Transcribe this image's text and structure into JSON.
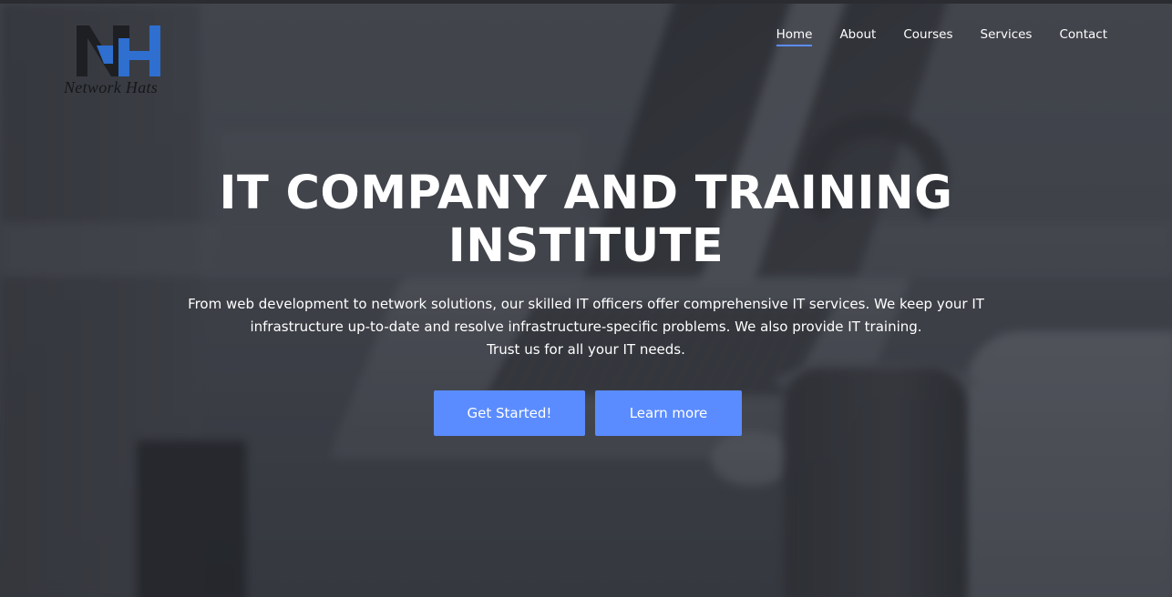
{
  "brand": {
    "logo_text": "Network Hats",
    "logo_icon": "nh-logo-icon",
    "logo_colors": {
      "dark": "#1e1f22",
      "blue": "#2e6fd0"
    }
  },
  "nav": {
    "items": [
      {
        "label": "Home",
        "active": true
      },
      {
        "label": "About",
        "active": false
      },
      {
        "label": "Courses",
        "active": false
      },
      {
        "label": "Services",
        "active": false
      },
      {
        "label": "Contact",
        "active": false
      }
    ],
    "active_color": "#5b8cff"
  },
  "hero": {
    "title_line1": "IT COMPANY AND TRAINING",
    "title_line2": "INSTITUTE",
    "description_line1": "From web development to network solutions, our skilled IT officers offer comprehensive IT services. We keep your IT",
    "description_line2": "infrastructure up-to-date and resolve infrastructure-specific problems. We also provide IT training.",
    "description_line3": "Trust us for all your IT needs.",
    "primary_button": "Get Started!",
    "secondary_button": "Learn more",
    "button_color": "#5b8cff"
  }
}
